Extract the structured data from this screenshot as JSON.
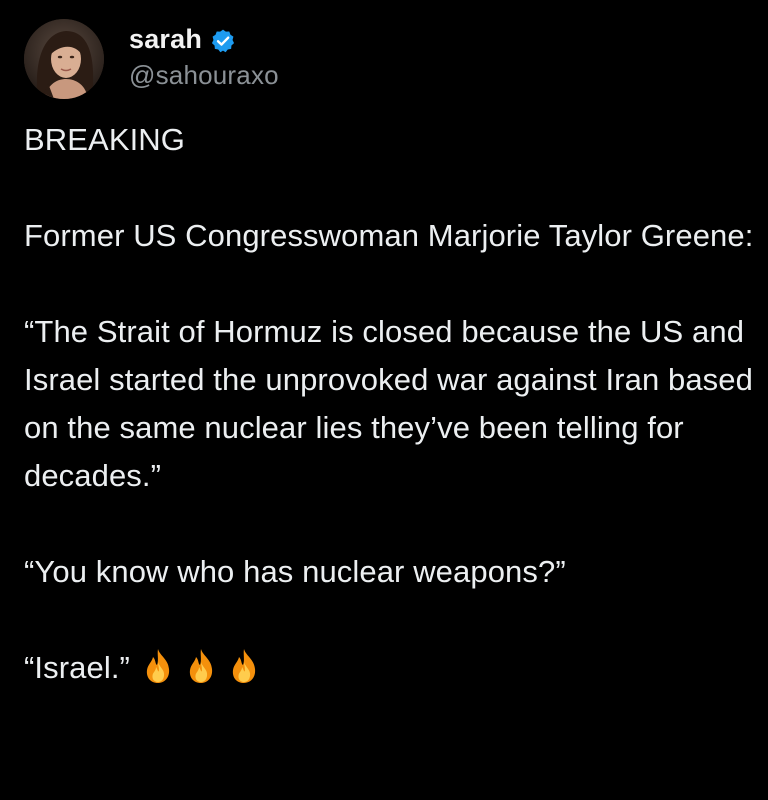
{
  "author": {
    "display_name": "sarah",
    "handle": "@sahouraxo",
    "verified": true,
    "verified_color": "#1d9bf0",
    "avatar_icon": "profile-photo"
  },
  "tweet": {
    "line_breaking": "BREAKING",
    "line_intro": "Former US Congresswoman Marjorie Taylor Greene:",
    "quote_1": "“The Strait of Hormuz is closed because the US and Israel started the unprovoked war against Iran based on the same nuclear lies they’ve been telling for decades.”",
    "quote_2": "“You know who has nuclear weapons?”",
    "quote_3": "“Israel.”",
    "emoji": [
      "fire-icon",
      "fire-icon",
      "fire-icon"
    ]
  },
  "colors": {
    "background": "#000000",
    "text": "#eceff1",
    "handle": "#8b9196"
  }
}
